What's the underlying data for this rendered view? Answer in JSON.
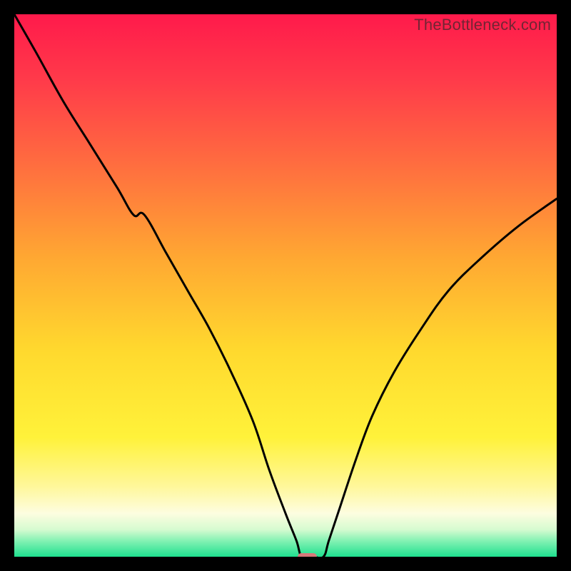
{
  "watermark": "TheBottleneck.com",
  "colors": {
    "frame_border": "#000000",
    "curve_stroke": "#000000",
    "marker_fill": "#d6787a"
  },
  "chart_data": {
    "type": "line",
    "title": "",
    "xlabel": "",
    "ylabel": "",
    "xlim": [
      0,
      100
    ],
    "ylim": [
      0,
      100
    ],
    "gradient_stops": [
      {
        "pct": 0,
        "color": "#ff1a4b"
      },
      {
        "pct": 12,
        "color": "#ff3a4a"
      },
      {
        "pct": 28,
        "color": "#ff6e3f"
      },
      {
        "pct": 45,
        "color": "#ffa832"
      },
      {
        "pct": 62,
        "color": "#ffd92e"
      },
      {
        "pct": 78,
        "color": "#fff23a"
      },
      {
        "pct": 87,
        "color": "#fff79a"
      },
      {
        "pct": 92,
        "color": "#fdfde0"
      },
      {
        "pct": 95,
        "color": "#d6fbd0"
      },
      {
        "pct": 97,
        "color": "#86f2b4"
      },
      {
        "pct": 100,
        "color": "#1fe08f"
      }
    ],
    "series": [
      {
        "name": "bottleneck-curve",
        "x": [
          0,
          4,
          9,
          14,
          19,
          22,
          24,
          28,
          32,
          36,
          40,
          44,
          47,
          50,
          52,
          53,
          55,
          57,
          58,
          60,
          63,
          66,
          70,
          75,
          80,
          86,
          93,
          100
        ],
        "y": [
          100,
          93,
          84,
          76,
          68,
          63,
          63,
          56,
          49,
          42,
          34,
          25,
          16,
          8,
          3,
          0,
          0,
          0,
          3,
          9,
          18,
          26,
          34,
          42,
          49,
          55,
          61,
          66
        ]
      }
    ],
    "marker": {
      "x": 54,
      "y": 0,
      "w": 3.5,
      "h": 1.4
    }
  }
}
